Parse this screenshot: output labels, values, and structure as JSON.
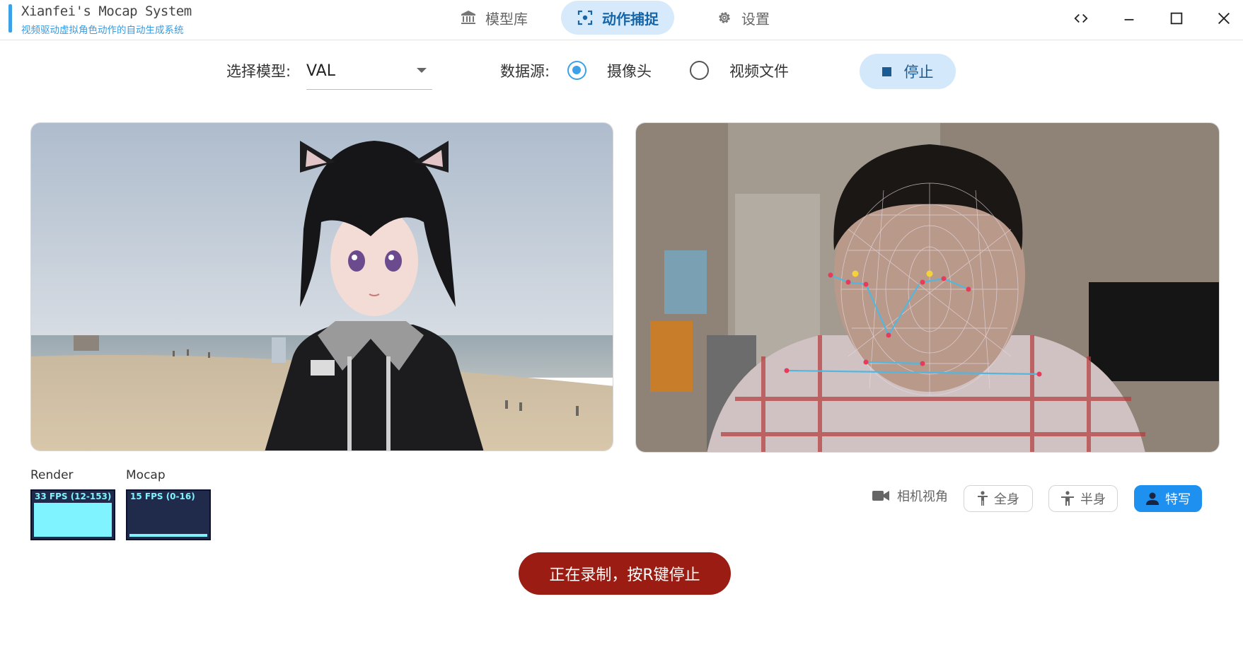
{
  "app": {
    "title": "Xianfei's Mocap System",
    "subtitle": "视频驱动虚拟角色动作的自动生成系统"
  },
  "nav": {
    "items": [
      {
        "label": "模型库",
        "icon": "bank-icon",
        "active": false
      },
      {
        "label": "动作捕捉",
        "icon": "focus-capture-icon",
        "active": true
      },
      {
        "label": "设置",
        "icon": "gear-icon",
        "active": false
      }
    ]
  },
  "window_controls": [
    "code-icon",
    "minimize-icon",
    "maximize-icon",
    "close-icon"
  ],
  "controls": {
    "model_label": "选择模型:",
    "model_value": "VAL",
    "source_label": "数据源:",
    "source_options": [
      {
        "label": "摄像头",
        "checked": true
      },
      {
        "label": "视频文件",
        "checked": false
      }
    ],
    "stop_label": "停止"
  },
  "stats": {
    "render": {
      "label": "Render",
      "text": "33 FPS (12-153)",
      "level": 0.92
    },
    "mocap": {
      "label": "Mocap",
      "text": "15 FPS (0-16)",
      "level": 0.08
    }
  },
  "camera_view": {
    "label": "相机视角",
    "options": [
      {
        "label": "全身",
        "icon": "person-standing-icon",
        "active": false
      },
      {
        "label": "半身",
        "icon": "person-half-icon",
        "active": false
      },
      {
        "label": "特写",
        "icon": "person-icon",
        "active": true
      }
    ]
  },
  "record_button": "正在录制，按R键停止",
  "colors": {
    "accent": "#3da1e8",
    "nav_active_bg": "#d6eafb",
    "record": "#9b1c12",
    "pill_active": "#1e90f0",
    "fps_text": "#7ff3ff"
  }
}
